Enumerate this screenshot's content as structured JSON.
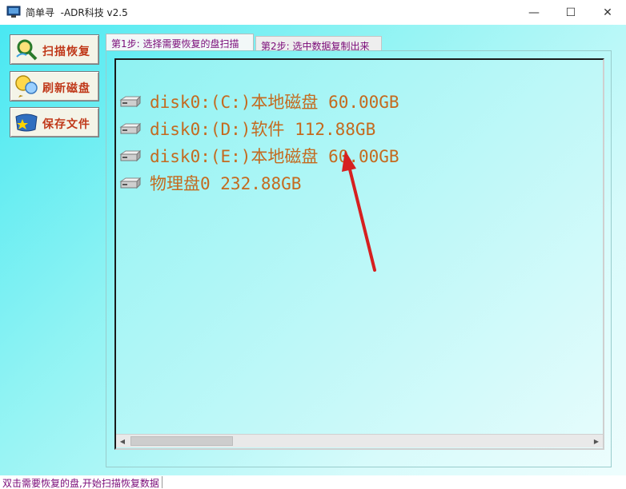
{
  "window": {
    "title": "简单寻  -ADR科技 v2.5",
    "controls": {
      "minimize": "—",
      "maximize": "☐",
      "close": "✕"
    }
  },
  "sidebar": {
    "buttons": [
      {
        "label": "扫描恢复",
        "icon": "magnifier-icon"
      },
      {
        "label": "刷新磁盘",
        "icon": "refresh-bubbles-icon"
      },
      {
        "label": "保存文件",
        "icon": "save-star-icon"
      }
    ]
  },
  "tabs": [
    {
      "label": "第1步: 选择需要恢复的盘扫描",
      "active": true
    },
    {
      "label": "第2步: 选中数据复制出来",
      "active": false
    }
  ],
  "disks": [
    {
      "label": "disk0:(C:)本地磁盘 60.00GB",
      "icon": "hard-drive-icon"
    },
    {
      "label": "disk0:(D:)软件 112.88GB",
      "icon": "hard-drive-icon"
    },
    {
      "label": "disk0:(E:)本地磁盘 60.00GB",
      "icon": "hard-drive-icon"
    },
    {
      "label": "物理盘0 232.88GB",
      "icon": "hard-drive-icon"
    }
  ],
  "scrollbar": {
    "left_arrow": "◀",
    "right_arrow": "▶"
  },
  "status": {
    "text": "双击需要恢复的盘,开始扫描恢复数据"
  },
  "colors": {
    "accent_text": "#c46a1f",
    "tab_text": "#7a0a78",
    "background": "#8ff3f3",
    "annotation_arrow": "#d62020"
  }
}
